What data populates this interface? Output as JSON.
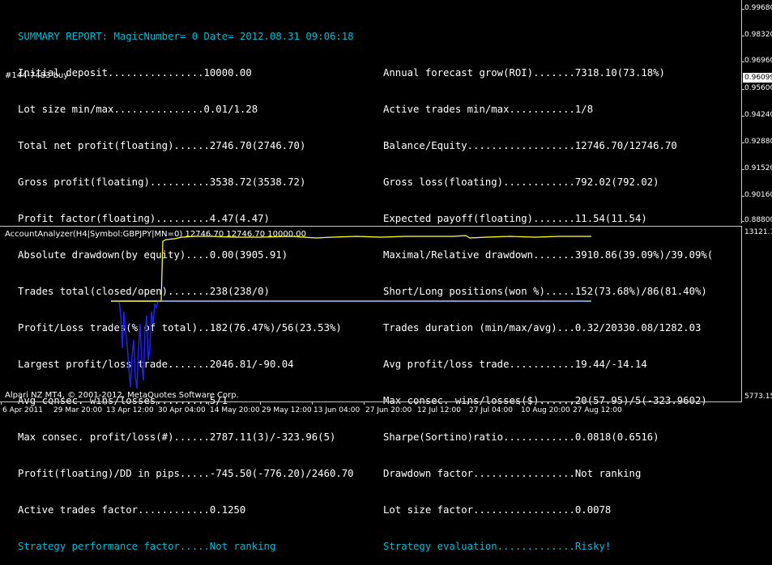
{
  "report": {
    "title": "SUMMARY REPORT: MagicNumber= 0 Date= 2012.08.31 09:06:18",
    "left": [
      "Initial deposit................10000.00",
      "Lot size min/max...............0.01/1.28",
      "Total net profit(floating)......2746.70(2746.70)",
      "Gross profit(floating)..........3538.72(3538.72)",
      "Profit factor(floating).........4.47(4.47)",
      "Absolute drawdown(by equity)....0.00(3905.91)",
      "Trades total(closed/open).......238(238/0)",
      "Profit/Loss trades(% of total)..182(76.47%)/56(23.53%)",
      "Largest profit/loss trade.......2046.81/-90.04",
      "Avg consec. wins/losses.........5/1",
      "Max consec. profit/loss(#)......2787.11(3)/-323.96(5)",
      "Profit(floating)/DD in pips.....-745.50(-776.20)/2460.70",
      "Active trades factor............0.1250",
      "Strategy performance factor.....Not ranking"
    ],
    "right": [
      "Annual forecast grow(ROI).......7318.10(73.18%)",
      "Active trades min/max...........1/8",
      "Balance/Equity..................12746.70/12746.70",
      "Gross loss(floating)............792.02(792.02)",
      "Expected payoff(floating).......11.54(11.54)",
      "Maximal/Relative drawdown.......3910.86(39.09%)/39.09%(",
      "Short/Long positions(won %).....152(73.68%)/86(81.40%)",
      "Trades duration (min/max/avg)...0.32/20330.08/1282.03",
      "Avg profit/loss trade...........19.44/-14.14",
      "Max consec. wins/losses($)......20(57.95)/5(-323.9602)",
      "Sharpe(Sortino)ratio............0.0818(0.6516)",
      "Drawdown factor.................Not ranking",
      "Lot size factor.................0.0078",
      "Strategy evaluation.............Risky!"
    ],
    "side_label": "#144-7483 buy"
  },
  "price_axis": {
    "labels": [
      "0.99680",
      "0.98320",
      "0.96960",
      "0.95600",
      "0.94240",
      "0.92880",
      "0.91520",
      "0.90160",
      "0.88800"
    ],
    "current": "0.96099"
  },
  "indicator": {
    "title": "AccountAnalyzer(H4|Symbol:GBPJPY|MN=0) 12746.70 12746.70 10000.00",
    "axis_top": "13121.1",
    "axis_bottom": "5773.15",
    "colors": {
      "balance": "#ffff00",
      "equity": "#1e1eff",
      "deposit": "#a0c8ff"
    }
  },
  "copyright": "Alpari NZ MT4, © 2001-2012, MetaQuotes Software Corp.",
  "time_axis": [
    "6 Apr 2011",
    "29 Mar 20:00",
    "13 Apr 12:00",
    "30 Apr 04:00",
    "14 May 20:00",
    "29 May 12:00",
    "13 Jun 04:00",
    "27 Jun 20:00",
    "12 Jul 12:00",
    "27 Jul 04:00",
    "10 Aug 20:00",
    "27 Aug 12:00"
  ]
}
